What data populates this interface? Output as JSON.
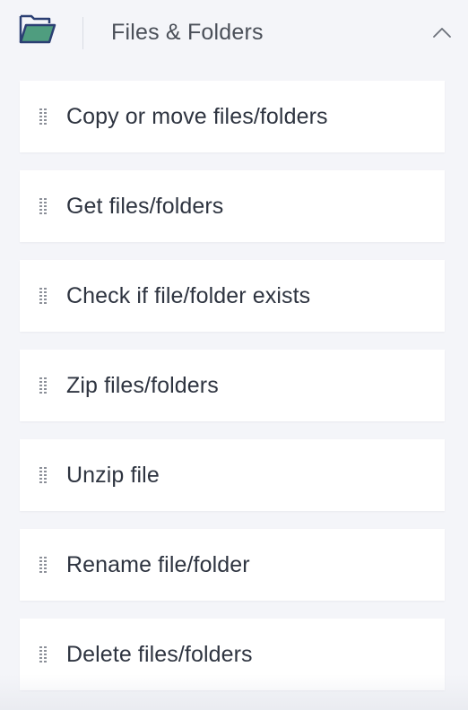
{
  "section": {
    "title": "Files & Folders",
    "icon": "folder-open-icon",
    "collapse_icon": "chevron-up-icon",
    "accent_color": "#4f9d7f",
    "outline_color": "#2b3f73"
  },
  "items": [
    {
      "label": "Copy or move files/folders"
    },
    {
      "label": "Get files/folders"
    },
    {
      "label": "Check if file/folder exists"
    },
    {
      "label": "Zip files/folders"
    },
    {
      "label": "Unzip file"
    },
    {
      "label": "Rename file/folder"
    },
    {
      "label": "Delete files/folders"
    }
  ]
}
